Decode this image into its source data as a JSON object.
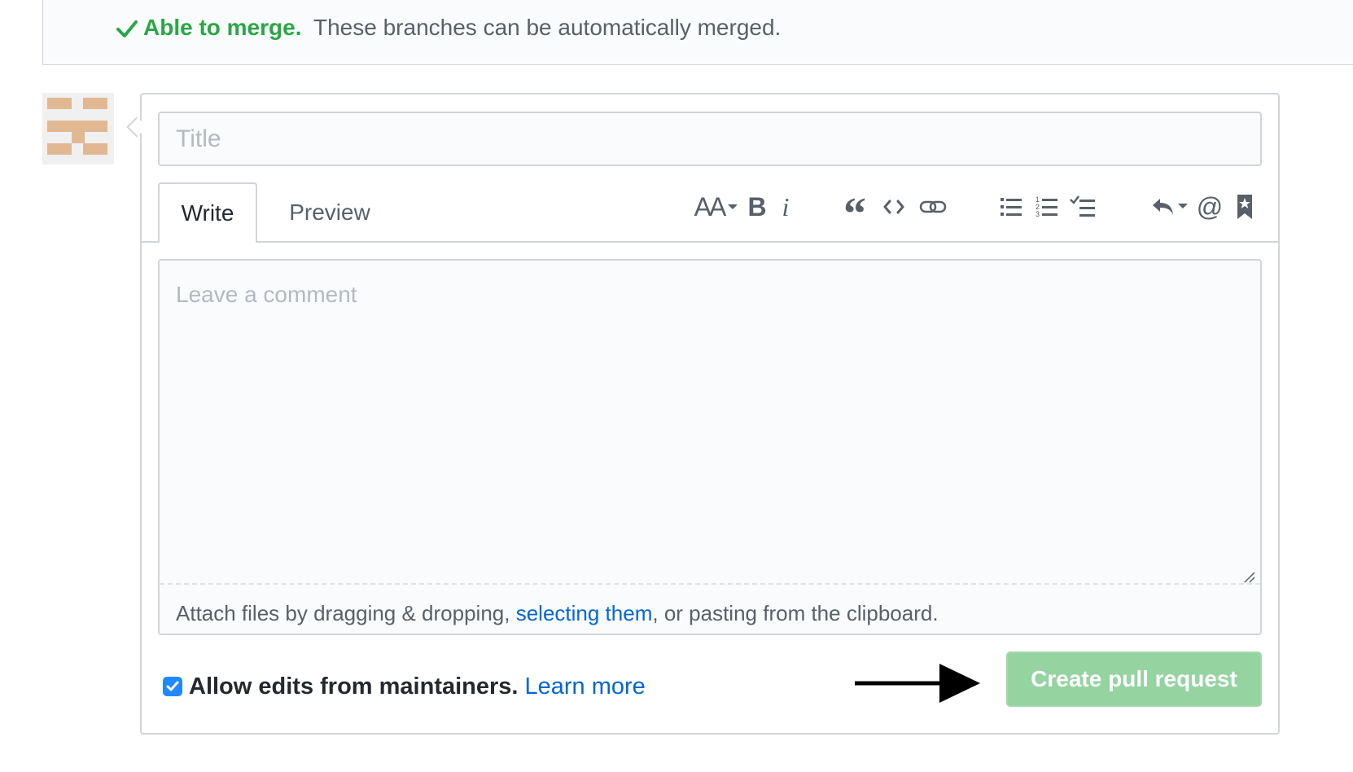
{
  "merge_status": {
    "strong": "Able to merge.",
    "text": "These branches can be automatically merged.",
    "color": "#28a745"
  },
  "form": {
    "title_placeholder": "Title",
    "tabs": [
      {
        "label": "Write",
        "selected": true
      },
      {
        "label": "Preview",
        "selected": false
      }
    ],
    "toolbar": [
      {
        "name": "header-icon",
        "text": "AA"
      },
      {
        "name": "bold-icon",
        "text": "B"
      },
      {
        "name": "italic-icon",
        "text": "i"
      },
      {
        "name": "quote-icon",
        "text": "“"
      },
      {
        "name": "code-icon"
      },
      {
        "name": "link-icon"
      },
      {
        "name": "bulleted-list-icon"
      },
      {
        "name": "numbered-list-icon"
      },
      {
        "name": "task-list-icon"
      },
      {
        "name": "reply-icon"
      },
      {
        "name": "mention-icon",
        "text": "@"
      },
      {
        "name": "saved-replies-icon"
      }
    ],
    "comment_placeholder": "Leave a comment",
    "attach": {
      "prefix": "Attach files by dragging & dropping,",
      "link": "selecting them",
      "suffix": ", or pasting from the clipboard."
    },
    "allow_edits": {
      "checked": true,
      "label": "Allow edits from maintainers.",
      "link": "Learn more"
    },
    "submit_label": "Create pull request"
  },
  "colors": {
    "link": "#0366d6",
    "button": "#95d3a0",
    "checkbox": "#2188ff"
  }
}
